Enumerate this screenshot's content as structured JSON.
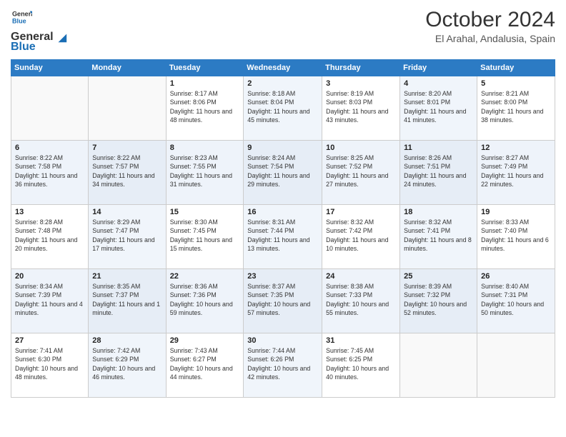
{
  "header": {
    "logo_general": "General",
    "logo_blue": "Blue",
    "month_title": "October 2024",
    "location": "El Arahal, Andalusia, Spain"
  },
  "weekdays": [
    "Sunday",
    "Monday",
    "Tuesday",
    "Wednesday",
    "Thursday",
    "Friday",
    "Saturday"
  ],
  "weeks": [
    {
      "days": [
        {
          "num": "",
          "info": ""
        },
        {
          "num": "",
          "info": ""
        },
        {
          "num": "1",
          "info": "Sunrise: 8:17 AM\nSunset: 8:06 PM\nDaylight: 11 hours and 48 minutes."
        },
        {
          "num": "2",
          "info": "Sunrise: 8:18 AM\nSunset: 8:04 PM\nDaylight: 11 hours and 45 minutes."
        },
        {
          "num": "3",
          "info": "Sunrise: 8:19 AM\nSunset: 8:03 PM\nDaylight: 11 hours and 43 minutes."
        },
        {
          "num": "4",
          "info": "Sunrise: 8:20 AM\nSunset: 8:01 PM\nDaylight: 11 hours and 41 minutes."
        },
        {
          "num": "5",
          "info": "Sunrise: 8:21 AM\nSunset: 8:00 PM\nDaylight: 11 hours and 38 minutes."
        }
      ]
    },
    {
      "days": [
        {
          "num": "6",
          "info": "Sunrise: 8:22 AM\nSunset: 7:58 PM\nDaylight: 11 hours and 36 minutes."
        },
        {
          "num": "7",
          "info": "Sunrise: 8:22 AM\nSunset: 7:57 PM\nDaylight: 11 hours and 34 minutes."
        },
        {
          "num": "8",
          "info": "Sunrise: 8:23 AM\nSunset: 7:55 PM\nDaylight: 11 hours and 31 minutes."
        },
        {
          "num": "9",
          "info": "Sunrise: 8:24 AM\nSunset: 7:54 PM\nDaylight: 11 hours and 29 minutes."
        },
        {
          "num": "10",
          "info": "Sunrise: 8:25 AM\nSunset: 7:52 PM\nDaylight: 11 hours and 27 minutes."
        },
        {
          "num": "11",
          "info": "Sunrise: 8:26 AM\nSunset: 7:51 PM\nDaylight: 11 hours and 24 minutes."
        },
        {
          "num": "12",
          "info": "Sunrise: 8:27 AM\nSunset: 7:49 PM\nDaylight: 11 hours and 22 minutes."
        }
      ]
    },
    {
      "days": [
        {
          "num": "13",
          "info": "Sunrise: 8:28 AM\nSunset: 7:48 PM\nDaylight: 11 hours and 20 minutes."
        },
        {
          "num": "14",
          "info": "Sunrise: 8:29 AM\nSunset: 7:47 PM\nDaylight: 11 hours and 17 minutes."
        },
        {
          "num": "15",
          "info": "Sunrise: 8:30 AM\nSunset: 7:45 PM\nDaylight: 11 hours and 15 minutes."
        },
        {
          "num": "16",
          "info": "Sunrise: 8:31 AM\nSunset: 7:44 PM\nDaylight: 11 hours and 13 minutes."
        },
        {
          "num": "17",
          "info": "Sunrise: 8:32 AM\nSunset: 7:42 PM\nDaylight: 11 hours and 10 minutes."
        },
        {
          "num": "18",
          "info": "Sunrise: 8:32 AM\nSunset: 7:41 PM\nDaylight: 11 hours and 8 minutes."
        },
        {
          "num": "19",
          "info": "Sunrise: 8:33 AM\nSunset: 7:40 PM\nDaylight: 11 hours and 6 minutes."
        }
      ]
    },
    {
      "days": [
        {
          "num": "20",
          "info": "Sunrise: 8:34 AM\nSunset: 7:39 PM\nDaylight: 11 hours and 4 minutes."
        },
        {
          "num": "21",
          "info": "Sunrise: 8:35 AM\nSunset: 7:37 PM\nDaylight: 11 hours and 1 minute."
        },
        {
          "num": "22",
          "info": "Sunrise: 8:36 AM\nSunset: 7:36 PM\nDaylight: 10 hours and 59 minutes."
        },
        {
          "num": "23",
          "info": "Sunrise: 8:37 AM\nSunset: 7:35 PM\nDaylight: 10 hours and 57 minutes."
        },
        {
          "num": "24",
          "info": "Sunrise: 8:38 AM\nSunset: 7:33 PM\nDaylight: 10 hours and 55 minutes."
        },
        {
          "num": "25",
          "info": "Sunrise: 8:39 AM\nSunset: 7:32 PM\nDaylight: 10 hours and 52 minutes."
        },
        {
          "num": "26",
          "info": "Sunrise: 8:40 AM\nSunset: 7:31 PM\nDaylight: 10 hours and 50 minutes."
        }
      ]
    },
    {
      "days": [
        {
          "num": "27",
          "info": "Sunrise: 7:41 AM\nSunset: 6:30 PM\nDaylight: 10 hours and 48 minutes."
        },
        {
          "num": "28",
          "info": "Sunrise: 7:42 AM\nSunset: 6:29 PM\nDaylight: 10 hours and 46 minutes."
        },
        {
          "num": "29",
          "info": "Sunrise: 7:43 AM\nSunset: 6:27 PM\nDaylight: 10 hours and 44 minutes."
        },
        {
          "num": "30",
          "info": "Sunrise: 7:44 AM\nSunset: 6:26 PM\nDaylight: 10 hours and 42 minutes."
        },
        {
          "num": "31",
          "info": "Sunrise: 7:45 AM\nSunset: 6:25 PM\nDaylight: 10 hours and 40 minutes."
        },
        {
          "num": "",
          "info": ""
        },
        {
          "num": "",
          "info": ""
        }
      ]
    }
  ]
}
